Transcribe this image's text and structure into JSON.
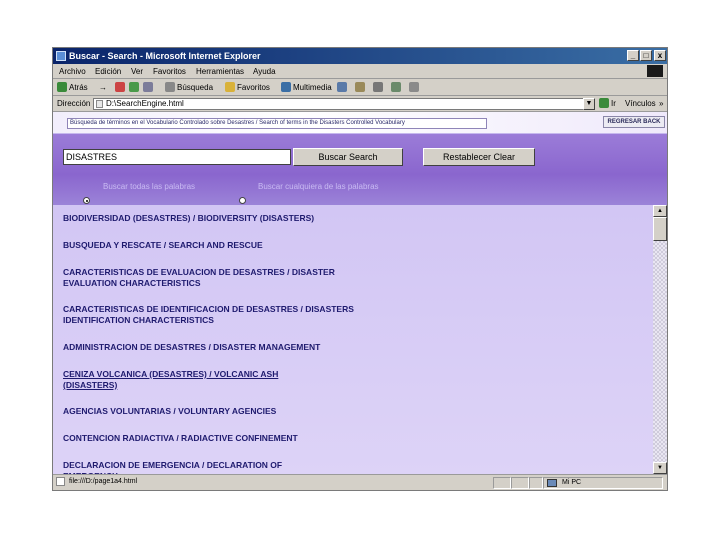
{
  "window": {
    "title": "Buscar - Search - Microsoft Internet Explorer",
    "minimize": "_",
    "maximize": "□",
    "close": "x"
  },
  "menu": [
    "Archivo",
    "Edición",
    "Ver",
    "Favoritos",
    "Herramientas",
    "Ayuda"
  ],
  "toolbar": {
    "back": "Atrás",
    "forward": "→",
    "search": "Búsqueda",
    "favorites": "Favoritos",
    "multimedia": "Multimedia"
  },
  "address": {
    "label": "Dirección",
    "url": "D:\\SearchEngine.html",
    "go": "Ir",
    "links": "Vínculos",
    "more": "»"
  },
  "page": {
    "header_text": "Búsqueda de términos en el Vocabulario Controlado sobre Desastres / Search of terms in the Disasters Controlled Vocabulary",
    "back_button": "REGRESAR  BACK",
    "search_value": "DISASTRES",
    "search_button": "Buscar   Search",
    "reset_button": "Restablecer   Clear",
    "radio_all": "Buscar todas las palabras",
    "radio_any": "Buscar cualquiera de las palabras"
  },
  "results": [
    {
      "text": "BIODIVERSIDAD (DESASTRES) / BIODIVERSITY (DISASTERS)"
    },
    {
      "text": "BUSQUEDA Y RESCATE / SEARCH AND RESCUE"
    },
    {
      "text": "CARACTERISTICAS DE EVALUACION DE DESASTRES / DISASTER EVALUATION CHARACTERISTICS"
    },
    {
      "text": "CARACTERISTICAS DE IDENTIFICACION DE DESASTRES / DISASTERS IDENTIFICATION CHARACTERISTICS"
    },
    {
      "text": "ADMINISTRACION DE DESASTRES / DISASTER MANAGEMENT"
    },
    {
      "text": "CENIZA VOLCANICA (DESASTRES) / VOLCANIC ASH (DISASTERS)"
    },
    {
      "text": "AGENCIAS VOLUNTARIAS / VOLUNTARY AGENCIES"
    },
    {
      "text": "CONTENCION RADIACTIVA / RADIACTIVE CONFINEMENT"
    },
    {
      "text": "DECLARACION DE EMERGENCIA / DECLARATION OF EMERGENCY"
    }
  ],
  "status": {
    "left": "file:///D:/page1a4.html",
    "zone": "Mi PC"
  },
  "colors": {
    "title_bar": "#0a246a",
    "chrome": "#d4d0c8",
    "band": "#8a66ce",
    "result_text": "#1e1a6e"
  }
}
